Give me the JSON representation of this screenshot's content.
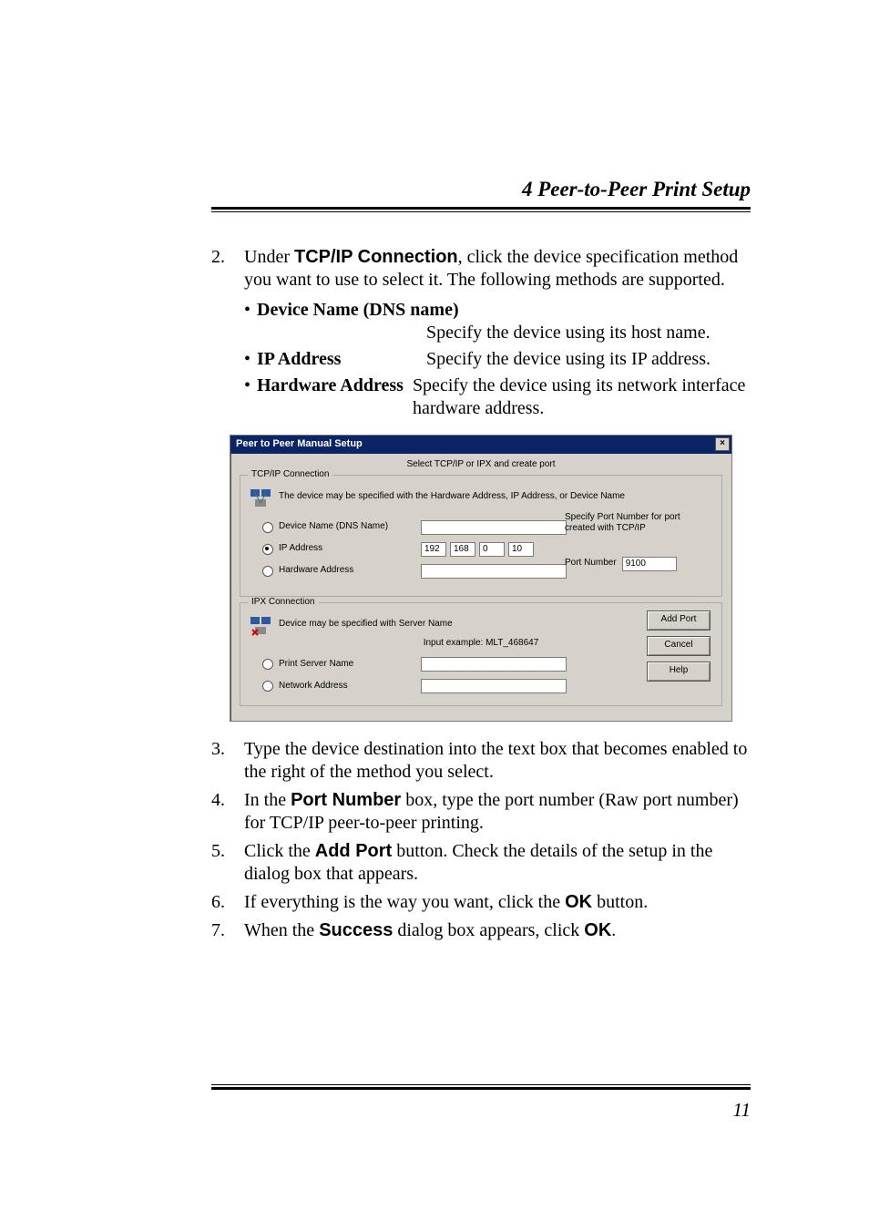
{
  "header": "4  Peer-to-Peer Print Setup",
  "step2": {
    "num": "2.",
    "text_prefix": "Under ",
    "text_bold": "TCP/IP Connection",
    "text_suffix": ", click the device specification method you want to use to select it. The following methods are supported."
  },
  "bullets": {
    "dot": "•",
    "dns": {
      "label": "Device Name (DNS name)",
      "desc": "Specify the device using its host name."
    },
    "ip": {
      "label": "IP Address",
      "desc": "Specify the device using its IP address."
    },
    "hw": {
      "label": "Hardware Address",
      "desc": "Specify the device using its network interface hardware address."
    }
  },
  "dialog": {
    "title": "Peer to Peer Manual Setup",
    "close": "×",
    "subtitle": "Select TCP/IP or IPX and create port",
    "tcpip": {
      "legend": "TCP/IP Connection",
      "desc": "The device may be specified with the Hardware Address, IP Address, or Device Name",
      "radios": {
        "dns": "Device Name (DNS Name)",
        "ip": "IP Address",
        "hw": "Hardware Address"
      },
      "octets": [
        "192",
        "168",
        "0",
        "10"
      ],
      "port_hint1": "Specify Port Number for port",
      "port_hint2": "created with TCP/IP",
      "port_label": "Port Number",
      "port_value": "9100"
    },
    "ipx": {
      "legend": "IPX Connection",
      "desc": "Device may be specified with Server Name",
      "example": "Input example: MLT_468647",
      "radios": {
        "psn": "Print Server Name",
        "net": "Network Address"
      },
      "buttons": {
        "add": "Add Port",
        "cancel": "Cancel",
        "help": "Help"
      }
    }
  },
  "step3": {
    "num": "3.",
    "text": "Type the device destination into the text box that becomes enabled to the right of the method you select."
  },
  "step4": {
    "num": "4.",
    "prefix": "In the ",
    "bold": "Port Number",
    "suffix": " box, type the port number (Raw port number) for TCP/IP peer-to-peer printing."
  },
  "step5": {
    "num": "5.",
    "prefix": "Click the ",
    "bold": "Add Port",
    "suffix": " button. Check the details of the setup in the dialog box that appears."
  },
  "step6": {
    "num": "6.",
    "prefix": "If everything is the way you want, click the ",
    "bold": "OK",
    "suffix": " button."
  },
  "step7": {
    "num": "7.",
    "prefix": "When the ",
    "bold": "Success",
    "mid": " dialog box appears, click ",
    "bold2": "OK",
    "suffix": "."
  },
  "page_number": "11"
}
